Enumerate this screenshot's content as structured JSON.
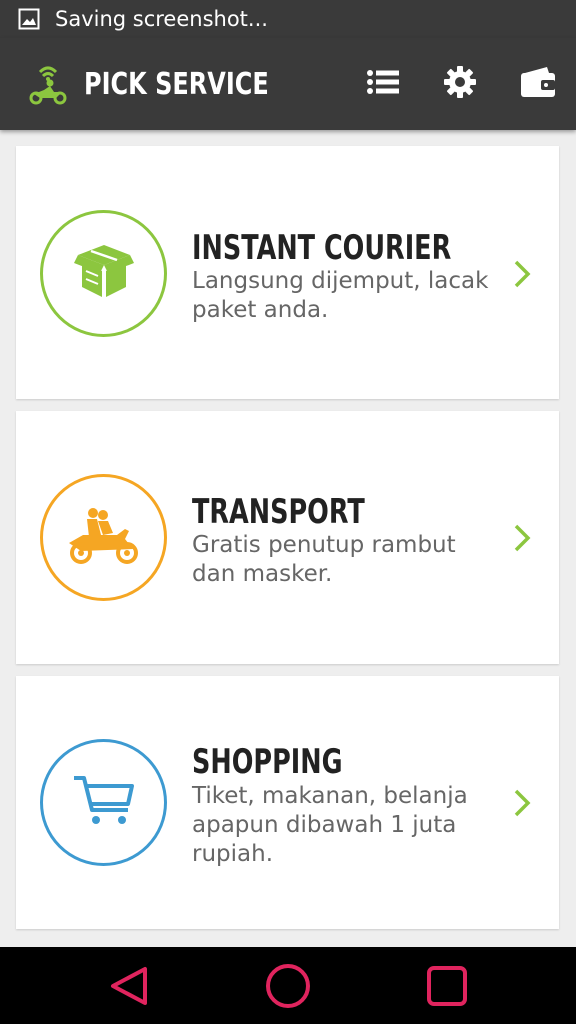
{
  "status_bar": {
    "text": "Saving screenshot...",
    "icon": "image-icon"
  },
  "app_bar": {
    "title": "PICK SERVICE",
    "logo": "motorbike-wifi-logo",
    "actions": [
      "list-icon",
      "gear-icon",
      "wallet-icon"
    ]
  },
  "services": [
    {
      "title": "INSTANT COURIER",
      "description": "Langsung dijemput, lacak paket anda.",
      "icon": "package-icon",
      "color": "#8cc63f"
    },
    {
      "title": "TRANSPORT",
      "description": "Gratis penutup rambut dan masker.",
      "icon": "motorbike-riders-icon",
      "color": "#f5a623"
    },
    {
      "title": "SHOPPING",
      "description": "Tiket, makanan, belanja apapun dibawah 1 juta rupiah.",
      "icon": "shopping-cart-icon",
      "color": "#3d9ad1"
    }
  ],
  "nav_bar": {
    "buttons": [
      "back-icon",
      "home-icon",
      "recents-icon"
    ],
    "color": "#e0245e"
  },
  "colors": {
    "chevron": "#8cc63f",
    "bar": "#3a3a3a"
  }
}
